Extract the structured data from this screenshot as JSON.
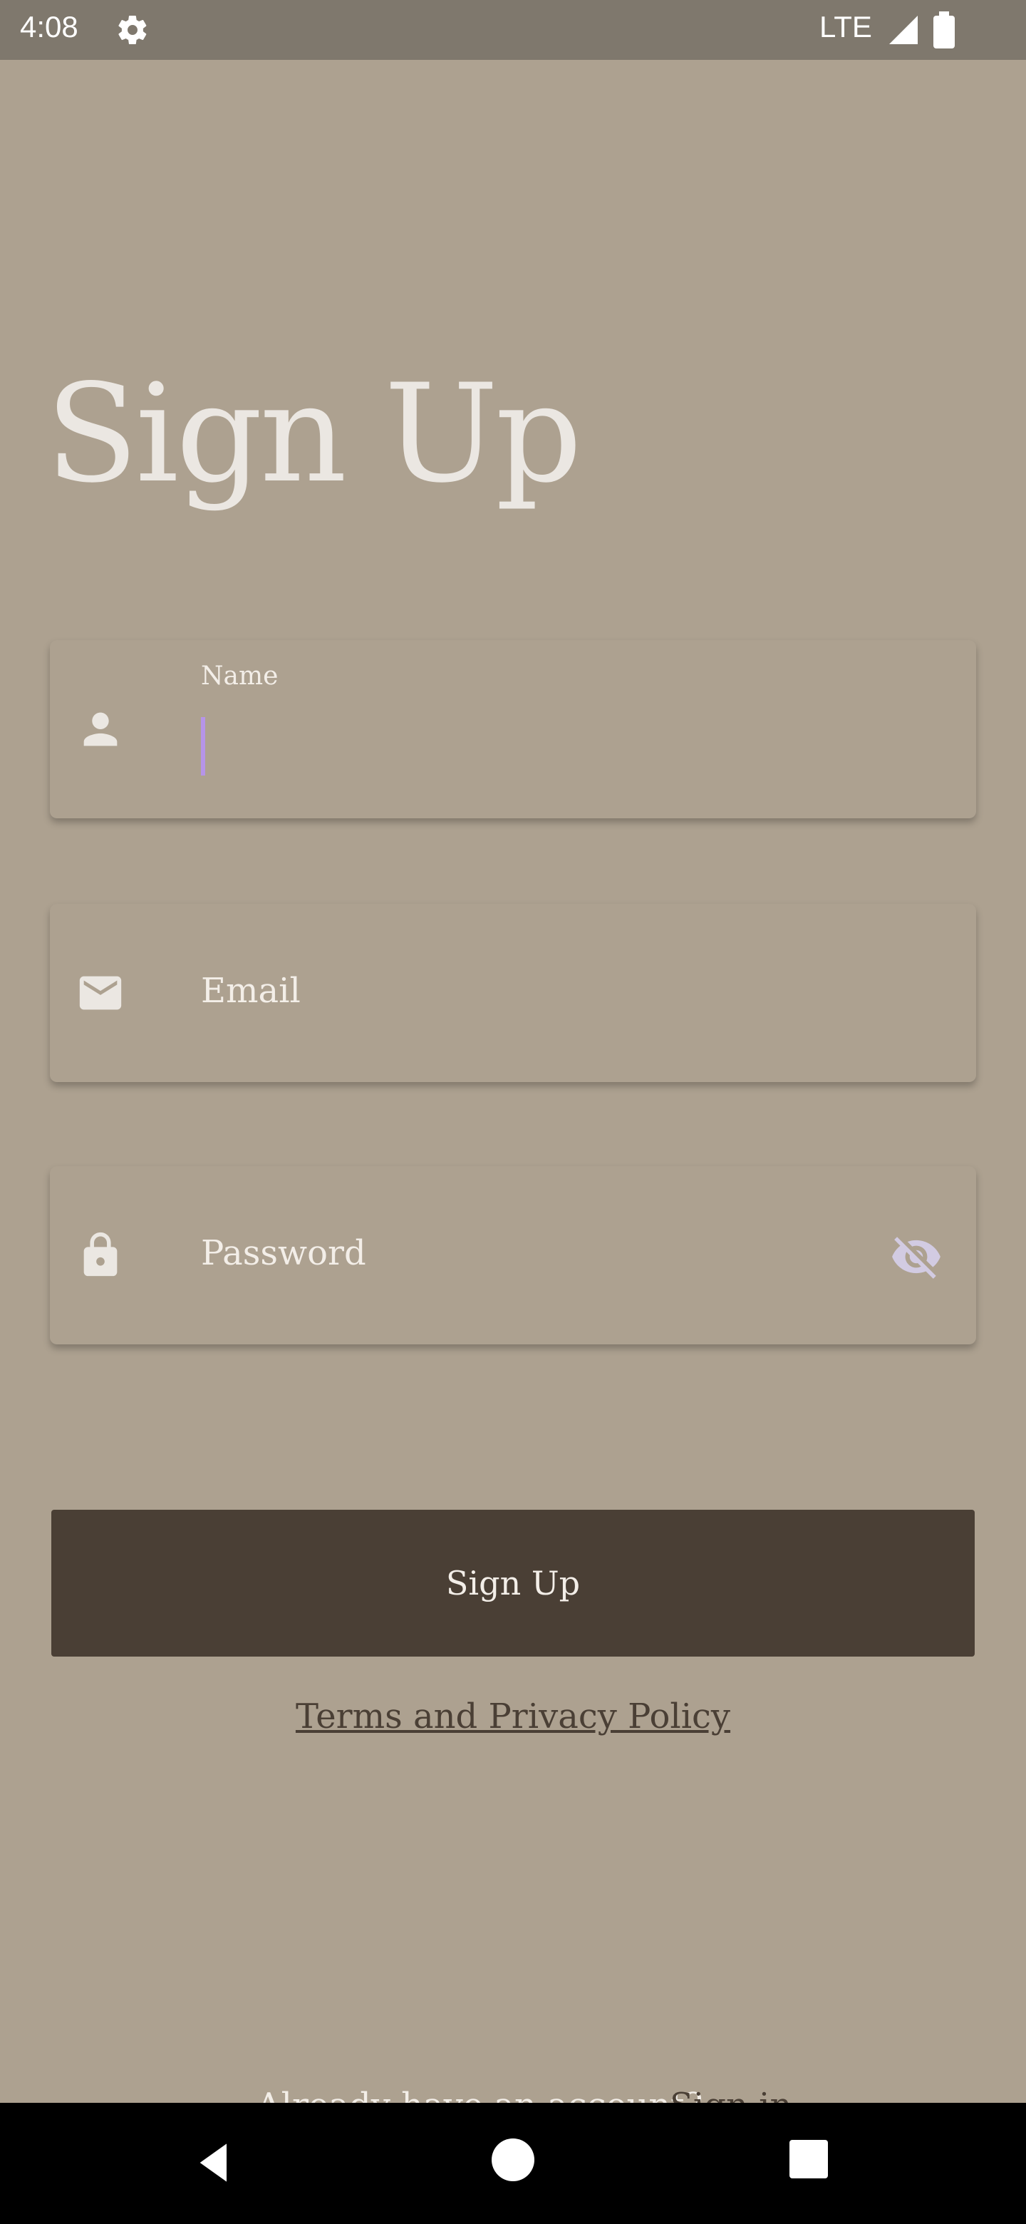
{
  "status_bar": {
    "time": "4:08",
    "network": "LTE",
    "icons": [
      "gear-icon",
      "signal-icon",
      "battery-icon"
    ]
  },
  "form": {
    "title": "Sign Up",
    "name_field": {
      "label": "Name",
      "value": "",
      "icon": "person-icon"
    },
    "email_field": {
      "placeholder": "Email",
      "icon": "mail-icon"
    },
    "password_field": {
      "placeholder": "Password",
      "icon": "lock-icon",
      "toggle_icon": "eye-off-icon"
    },
    "submit_label": "Sign Up",
    "terms_link": "Terms and Privacy Policy",
    "already_text": "Already have an account?",
    "signin_link": "Sign in"
  },
  "colors": {
    "background": "#ada190",
    "button": "#4a3f35",
    "text_light": "#f3eee8",
    "cursor": "#b694e8"
  },
  "nav_bar": {
    "icons": [
      "back-icon",
      "home-icon",
      "recents-icon"
    ]
  }
}
